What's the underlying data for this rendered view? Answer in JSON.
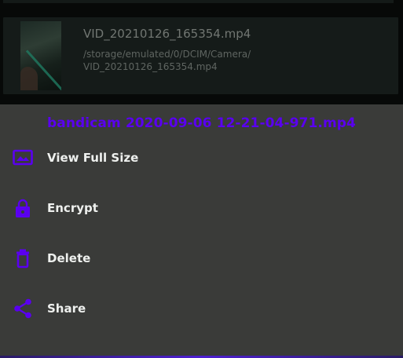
{
  "file": {
    "name": "VID_20210126_165354.mp4",
    "path": "/storage/emulated/0/DCIM/Camera/\nVID_20210126_165354.mp4"
  },
  "sheet": {
    "title": "bandicam 2020-09-06 12-21-04-971.mp4",
    "items": [
      {
        "label": "View Full Size",
        "icon": "image-icon"
      },
      {
        "label": "Encrypt",
        "icon": "lock-icon"
      },
      {
        "label": "Delete",
        "icon": "trash-icon"
      },
      {
        "label": "Share",
        "icon": "share-icon"
      }
    ]
  },
  "colors": {
    "accent": "#5a00f0",
    "sheet_bg": "#3a3b39",
    "card_bg": "#151b19"
  }
}
